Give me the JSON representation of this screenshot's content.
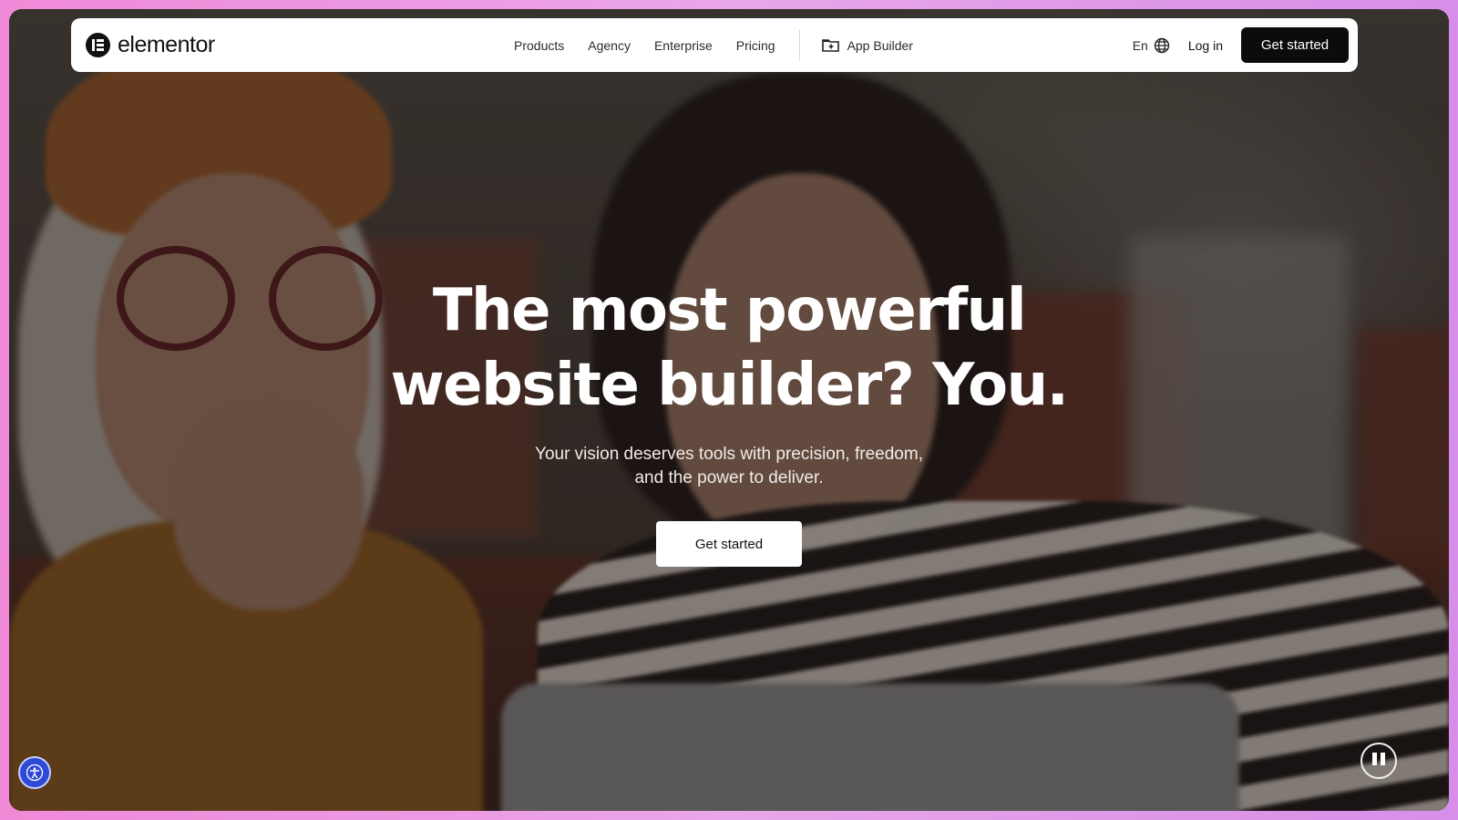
{
  "brand": {
    "logo_text": "elementor",
    "logo_icon": "elementor-logo-icon"
  },
  "nav": {
    "links": [
      "Products",
      "Agency",
      "Enterprise",
      "Pricing"
    ],
    "app_builder_label": "App Builder",
    "app_builder_icon": "app-builder-icon",
    "language": "En",
    "language_icon": "globe-icon",
    "login_label": "Log in",
    "cta_label": "Get started"
  },
  "hero": {
    "title_line1": "The most powerful",
    "title_line2": "website builder? You.",
    "subtitle_line1": "Your vision deserves tools with precision, freedom,",
    "subtitle_line2": "and the power to deliver.",
    "cta_label": "Get started"
  },
  "controls": {
    "accessibility_icon": "accessibility-icon",
    "pause_icon": "pause-icon"
  },
  "colors": {
    "nav_bg": "#ffffff",
    "cta_dark": "#0c0c0c",
    "hero_text": "#ffffff",
    "accessibility_blue": "#2d49d6",
    "frame_gradient_left": "#f08ad8",
    "frame_gradient_right": "#d78ee8"
  }
}
